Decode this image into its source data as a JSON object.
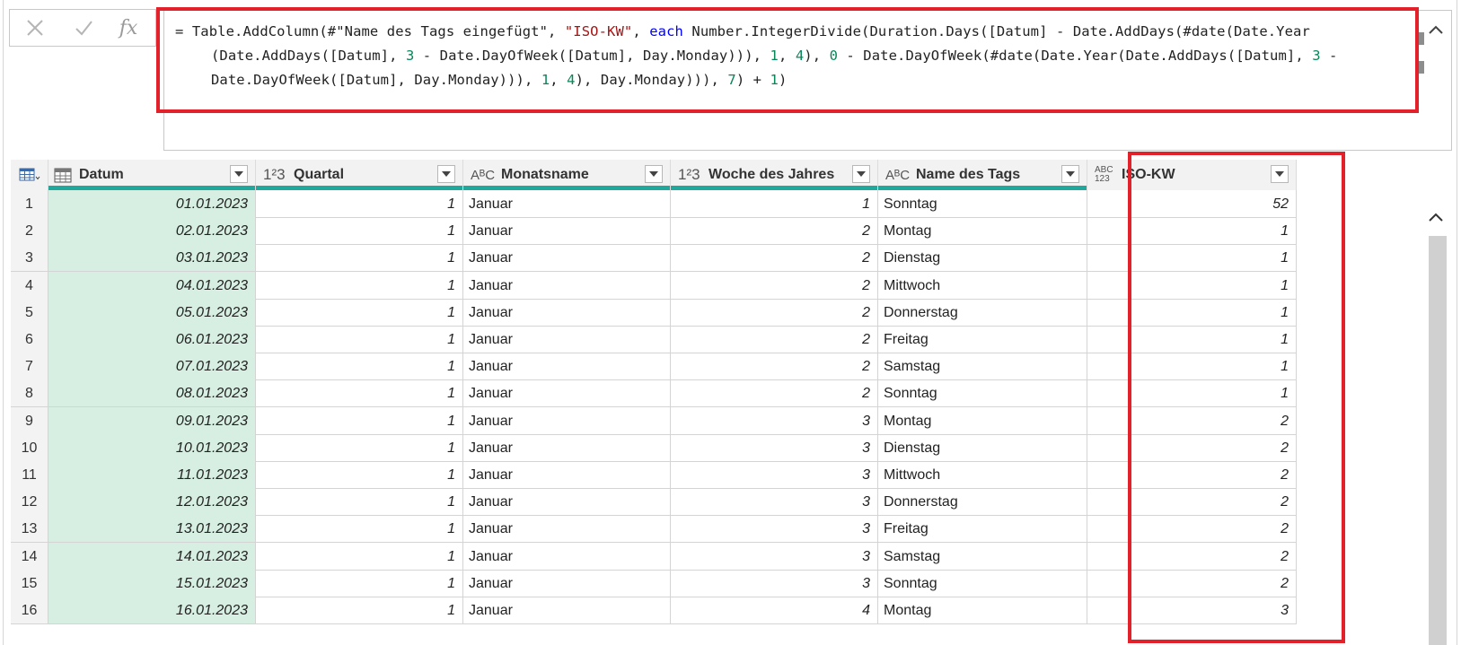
{
  "formula_bar": {
    "cancel_icon": "close-icon",
    "confirm_icon": "check-icon",
    "fx_label": "fx",
    "line1": {
      "p1": "= Table.AddColumn(#\"Name des Tags eingefügt\", ",
      "s1": "\"ISO-KW\"",
      "p2": ", ",
      "k1": "each",
      "p3": " Number.IntegerDivide(Duration.Days([Datum] - Date.AddDays(#date(Date.Year"
    },
    "line2": {
      "p1": "(Date.AddDays([Datum], ",
      "n1": "3",
      "p2": " - Date.DayOfWeek([Datum], Day.Monday))), ",
      "n2": "1",
      "p3": ", ",
      "n3": "4",
      "p4": "), ",
      "n4": "0",
      "p5": " - Date.DayOfWeek(#date(Date.Year(Date.AddDays([Datum], ",
      "n5": "3",
      "p6": " -"
    },
    "line3": {
      "p1": "Date.DayOfWeek([Datum], Day.Monday))), ",
      "n1": "1",
      "p2": ", ",
      "n2": "4",
      "p3": "), Day.Monday))), ",
      "n3": "7",
      "p4": ") + ",
      "n4": "1",
      "p5": ")"
    }
  },
  "table": {
    "columns": [
      {
        "type_icon": "",
        "label": "Datum"
      },
      {
        "type_icon": "1²3",
        "label": "Quartal"
      },
      {
        "type_icon": "AᴮC",
        "label": "Monatsname"
      },
      {
        "type_icon": "1²3",
        "label": "Woche des Jahres"
      },
      {
        "type_icon": "AᴮC",
        "label": "Name des Tags"
      },
      {
        "type_icon": "ABC123",
        "label": "ISO-KW"
      }
    ],
    "rows": [
      {
        "n": "1",
        "datum": "01.01.2023",
        "quartal": "1",
        "monat": "Januar",
        "woche": "1",
        "tag": "Sonntag",
        "isokw": "52"
      },
      {
        "n": "2",
        "datum": "02.01.2023",
        "quartal": "1",
        "monat": "Januar",
        "woche": "2",
        "tag": "Montag",
        "isokw": "1"
      },
      {
        "n": "3",
        "datum": "03.01.2023",
        "quartal": "1",
        "monat": "Januar",
        "woche": "2",
        "tag": "Dienstag",
        "isokw": "1"
      },
      {
        "n": "4",
        "datum": "04.01.2023",
        "quartal": "1",
        "monat": "Januar",
        "woche": "2",
        "tag": "Mittwoch",
        "isokw": "1"
      },
      {
        "n": "5",
        "datum": "05.01.2023",
        "quartal": "1",
        "monat": "Januar",
        "woche": "2",
        "tag": "Donnerstag",
        "isokw": "1"
      },
      {
        "n": "6",
        "datum": "06.01.2023",
        "quartal": "1",
        "monat": "Januar",
        "woche": "2",
        "tag": "Freitag",
        "isokw": "1"
      },
      {
        "n": "7",
        "datum": "07.01.2023",
        "quartal": "1",
        "monat": "Januar",
        "woche": "2",
        "tag": "Samstag",
        "isokw": "1"
      },
      {
        "n": "8",
        "datum": "08.01.2023",
        "quartal": "1",
        "monat": "Januar",
        "woche": "2",
        "tag": "Sonntag",
        "isokw": "1"
      },
      {
        "n": "9",
        "datum": "09.01.2023",
        "quartal": "1",
        "monat": "Januar",
        "woche": "3",
        "tag": "Montag",
        "isokw": "2"
      },
      {
        "n": "10",
        "datum": "10.01.2023",
        "quartal": "1",
        "monat": "Januar",
        "woche": "3",
        "tag": "Dienstag",
        "isokw": "2"
      },
      {
        "n": "11",
        "datum": "11.01.2023",
        "quartal": "1",
        "monat": "Januar",
        "woche": "3",
        "tag": "Mittwoch",
        "isokw": "2"
      },
      {
        "n": "12",
        "datum": "12.01.2023",
        "quartal": "1",
        "monat": "Januar",
        "woche": "3",
        "tag": "Donnerstag",
        "isokw": "2"
      },
      {
        "n": "13",
        "datum": "13.01.2023",
        "quartal": "1",
        "monat": "Januar",
        "woche": "3",
        "tag": "Freitag",
        "isokw": "2"
      },
      {
        "n": "14",
        "datum": "14.01.2023",
        "quartal": "1",
        "monat": "Januar",
        "woche": "3",
        "tag": "Samstag",
        "isokw": "2"
      },
      {
        "n": "15",
        "datum": "15.01.2023",
        "quartal": "1",
        "monat": "Januar",
        "woche": "3",
        "tag": "Sonntag",
        "isokw": "2"
      },
      {
        "n": "16",
        "datum": "16.01.2023",
        "quartal": "1",
        "monat": "Januar",
        "woche": "4",
        "tag": "Montag",
        "isokw": "3"
      }
    ]
  },
  "colors": {
    "highlight": "#e3212b",
    "accent_bar": "#1fa89b",
    "datum_bg": "#d7efe2"
  }
}
